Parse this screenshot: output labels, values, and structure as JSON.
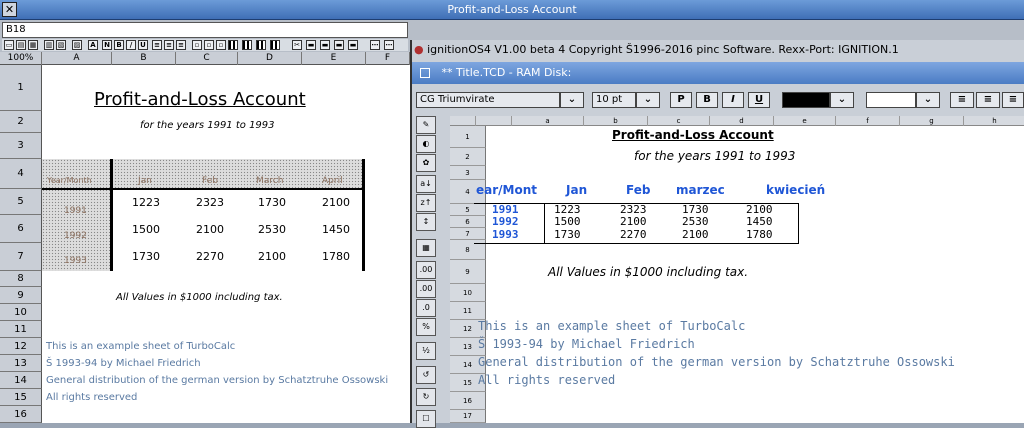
{
  "win1": {
    "title": "Profit-and-Loss Account",
    "cellref": "B18",
    "zoom": "100%",
    "columns": [
      "A",
      "B",
      "C",
      "D",
      "E",
      "F"
    ],
    "rows": [
      "1",
      "2",
      "3",
      "4",
      "5",
      "6",
      "7",
      "8",
      "9",
      "10",
      "11",
      "12",
      "13",
      "14",
      "15",
      "16"
    ],
    "subtitle": "for the years 1991 to 1993",
    "hdr_yearmonth": "Year/Month",
    "months": [
      "Jan",
      "Feb",
      "March",
      "April"
    ],
    "years": [
      "1991",
      "1992",
      "1993"
    ],
    "values": [
      [
        "1223",
        "2323",
        "1730",
        "2100"
      ],
      [
        "1500",
        "2100",
        "2530",
        "1450"
      ],
      [
        "1730",
        "2270",
        "2100",
        "1780"
      ]
    ],
    "note": "All Values in $1000 including tax.",
    "lines": [
      "This is an example sheet of TurboCalc",
      "Š 1993-94 by Michael Friedrich",
      "General distribution of the german version by Schatztruhe Ossowski",
      "All rights reserved"
    ]
  },
  "win2": {
    "app_title": "ignitionOS4  V1.00 beta 4   Copyright Š1996-2016 pinc Software.   Rexx-Port: IGNITION.1",
    "doc_title": "** Title.TCD  -  RAM Disk:",
    "font": "CG Triumvirate",
    "size": "10 pt",
    "fmt_buttons": [
      "P",
      "B",
      "I",
      "U"
    ],
    "columns": [
      "a",
      "b",
      "c",
      "d",
      "e",
      "f",
      "g",
      "h"
    ],
    "rows": [
      "1",
      "2",
      "3",
      "4",
      "5",
      "6",
      "7",
      "8",
      "9",
      "10",
      "11",
      "12",
      "13",
      "14",
      "15",
      "16",
      "17"
    ],
    "title": "Profit-and-Loss Account",
    "subtitle": "for the years 1991 to 1993",
    "hdr_yearmonth": "ear/Mont",
    "months": [
      "Jan",
      "Feb",
      "marzec",
      "kwiecień"
    ],
    "years": [
      "1991",
      "1992",
      "1993"
    ],
    "values": [
      [
        "1223",
        "2323",
        "1730",
        "2100"
      ],
      [
        "1500",
        "2100",
        "2530",
        "1450"
      ],
      [
        "1730",
        "2270",
        "2100",
        "1780"
      ]
    ],
    "note": "All Values in $1000 including tax.",
    "lines": [
      "This is an example sheet of TurboCalc",
      "Š 1993-94 by Michael Friedrich",
      "General distribution of the german version by Schatztruhe Ossowski",
      "All rights reserved"
    ]
  }
}
